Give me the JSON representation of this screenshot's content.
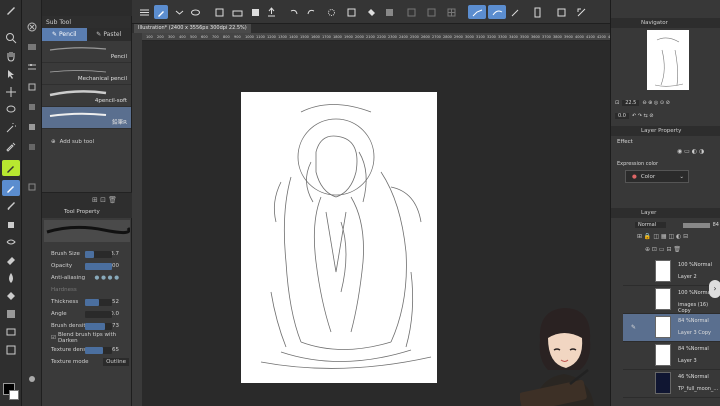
{
  "window": {
    "title": "Illustration* (2400 x 3556px 300dpi 22.5%)"
  },
  "subtool": {
    "header": "Sub Tool",
    "tabs": [
      {
        "label": "Pencil"
      },
      {
        "label": "Pastel"
      }
    ],
    "brushes": [
      {
        "label": "Pencil"
      },
      {
        "label": "Mechanical pencil"
      },
      {
        "label": "4pencil-soft"
      },
      {
        "label": "鉛筆R"
      }
    ],
    "add_label": "Add sub tool"
  },
  "toolprop": {
    "header": "Tool Property",
    "brush_name": "鉛筆R",
    "rows": [
      {
        "label": "Brush Size",
        "value": "28.7",
        "fill": 0.35
      },
      {
        "label": "Opacity",
        "value": "100",
        "fill": 1.0
      },
      {
        "label": "Anti-aliasing",
        "value": ""
      },
      {
        "label": "Hardness",
        "value": ""
      },
      {
        "label": "Thickness",
        "value": "52",
        "fill": 0.52
      },
      {
        "label": "Angle",
        "value": "0.0",
        "fill": 0.0
      },
      {
        "label": "Brush density",
        "value": "73",
        "fill": 0.73
      },
      {
        "label": "Blend brush tips with Darken",
        "value": ""
      },
      {
        "label": "Texture density",
        "value": "65",
        "fill": 0.65
      },
      {
        "label": "Texture mode",
        "value": "Outline"
      }
    ]
  },
  "navigator": {
    "header": "Navigator",
    "zoom": "22.5",
    "rotation": "0.0"
  },
  "layer_property": {
    "header": "Layer Property",
    "effect": "Effect",
    "expression_label": "Expression color",
    "expression_value": "Color"
  },
  "layers": {
    "header": "Layer",
    "blend": "Normal",
    "opacity": "84",
    "items": [
      {
        "mode": "100 %Normal",
        "name": "Layer 2"
      },
      {
        "mode": "100 %Normal",
        "name": "images (16) Copy"
      },
      {
        "mode": "84 %Normal",
        "name": "Layer 3 Copy",
        "selected": true
      },
      {
        "mode": "84 %Normal",
        "name": "Layer 3"
      },
      {
        "mode": "46 %Normal",
        "name": "TP_full_moon_..."
      }
    ]
  },
  "ruler_ticks": [
    "100",
    "200",
    "300",
    "400",
    "500",
    "600",
    "700",
    "800",
    "900",
    "1000",
    "1100",
    "1200",
    "1300",
    "1400",
    "1500",
    "1600",
    "1700",
    "1800",
    "1900",
    "2000",
    "2100",
    "2200",
    "2300",
    "2400",
    "2500",
    "2600",
    "2700",
    "2800",
    "2900",
    "3000",
    "3100",
    "3200",
    "3300",
    "3400",
    "3500",
    "3600",
    "3700",
    "3800",
    "3900",
    "4000",
    "4100",
    "4200",
    "4300"
  ],
  "colors": {
    "accent": "#5b8dcf",
    "selected": "#5a6f8f",
    "main_color": "#000000",
    "sub_color": "#ffffff"
  }
}
